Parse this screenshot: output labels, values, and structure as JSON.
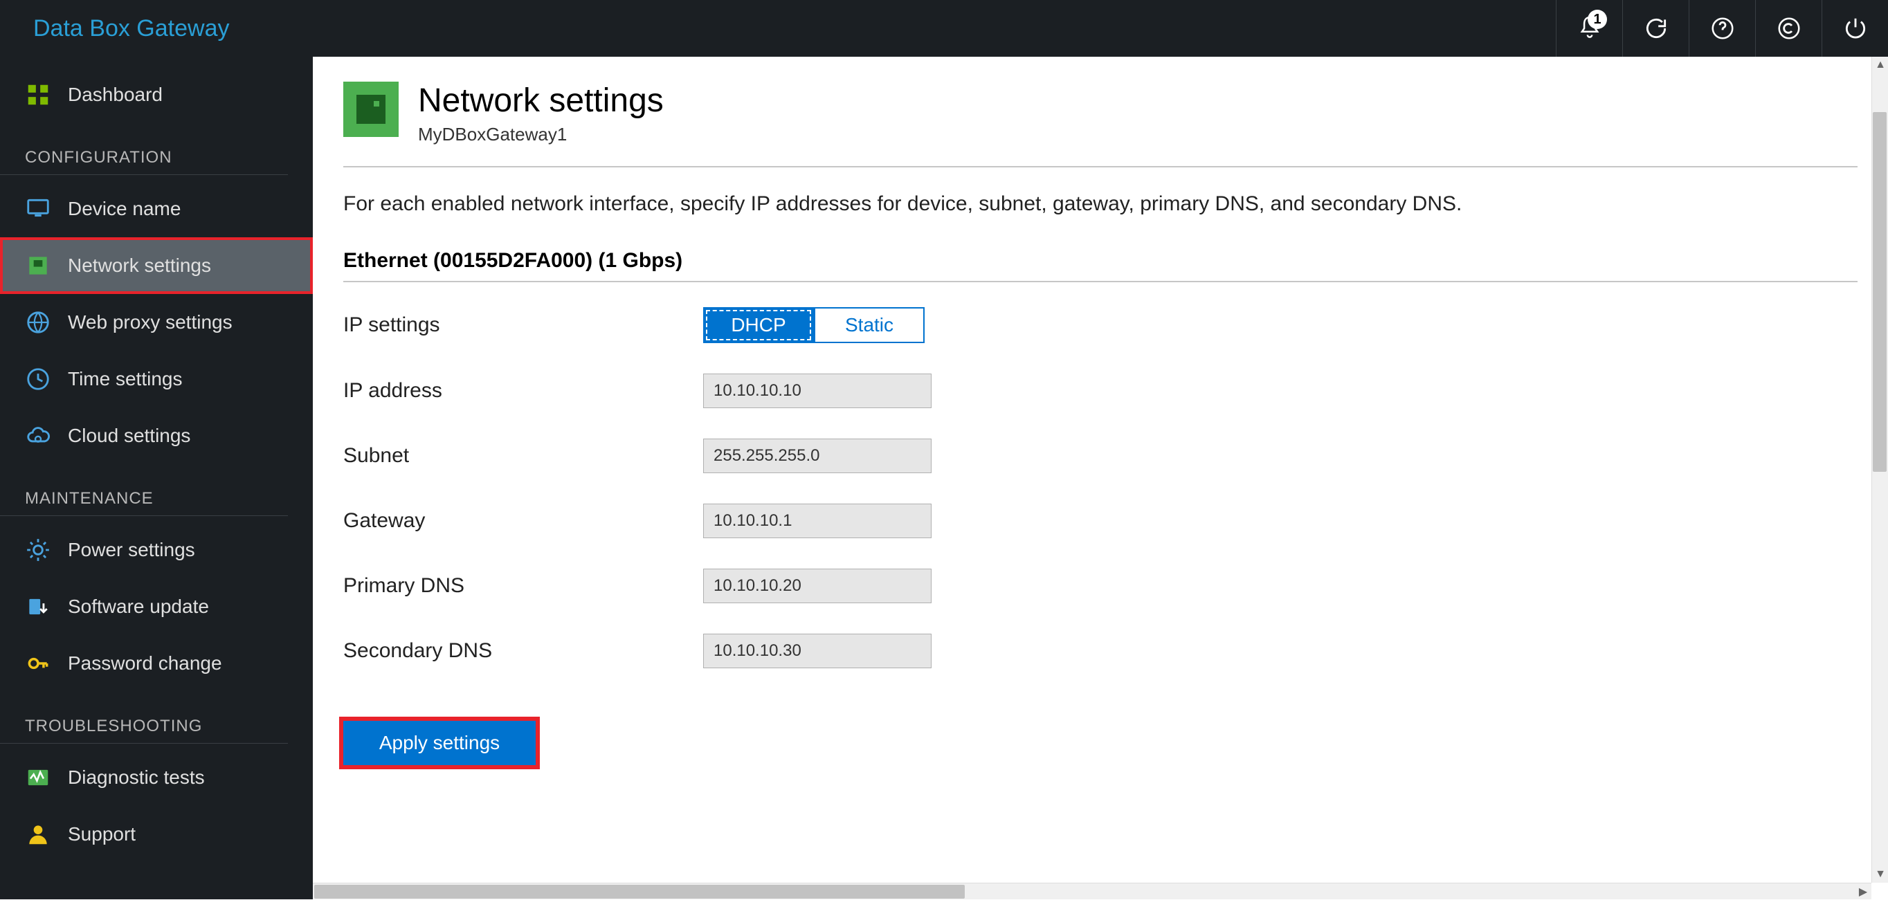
{
  "brand": "Data Box Gateway",
  "topIcons": {
    "notificationBadge": "1"
  },
  "sidebar": {
    "dashboard": "Dashboard",
    "sections": {
      "configuration": {
        "header": "CONFIGURATION",
        "deviceName": "Device name",
        "networkSettings": "Network settings",
        "webProxySettings": "Web proxy settings",
        "timeSettings": "Time settings",
        "cloudSettings": "Cloud settings"
      },
      "maintenance": {
        "header": "MAINTENANCE",
        "powerSettings": "Power settings",
        "softwareUpdate": "Software update",
        "passwordChange": "Password change"
      },
      "troubleshooting": {
        "header": "TROUBLESHOOTING",
        "diagnosticTests": "Diagnostic tests",
        "support": "Support"
      }
    }
  },
  "page": {
    "title": "Network settings",
    "subtitle": "MyDBoxGateway1",
    "intro": "For each enabled network interface, specify IP addresses for device, subnet, gateway, primary DNS, and secondary DNS.",
    "interfaceTitle": "Ethernet (00155D2FA000) (1 Gbps)",
    "labels": {
      "ipSettings": "IP settings",
      "ipAddress": "IP address",
      "subnet": "Subnet",
      "gateway": "Gateway",
      "primaryDNS": "Primary DNS",
      "secondaryDNS": "Secondary DNS"
    },
    "toggles": {
      "dhcp": "DHCP",
      "static": "Static"
    },
    "values": {
      "ipAddress": "10.10.10.10",
      "subnet": "255.255.255.0",
      "gateway": "10.10.10.1",
      "primaryDNS": "10.10.10.20",
      "secondaryDNS": "10.10.10.30"
    },
    "applyButton": "Apply settings"
  }
}
